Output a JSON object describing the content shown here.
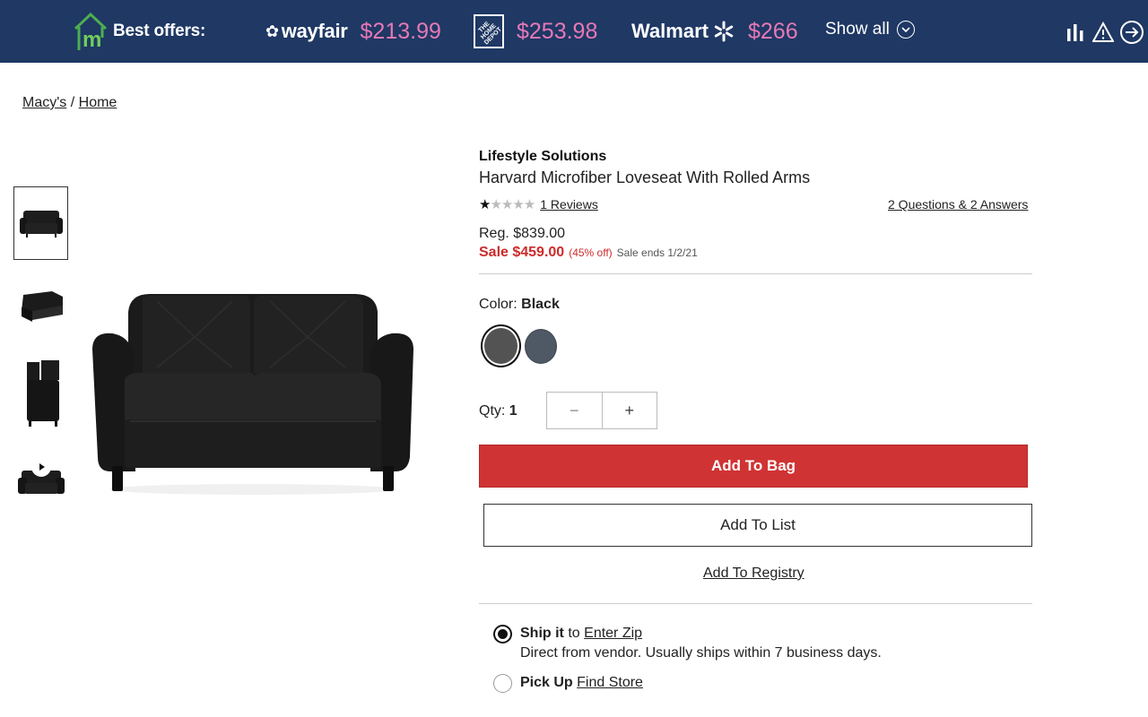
{
  "offers_bar": {
    "label": "Best offers:",
    "stores": [
      {
        "name": "wayfair",
        "price": "$213.99"
      },
      {
        "name": "THE HOME DEPOT",
        "price": "$253.98"
      },
      {
        "name": "Walmart",
        "price": "$266"
      }
    ],
    "show_all": "Show all",
    "bg_color": "#1f3864",
    "price_color": "#e679b6",
    "icons": [
      "m-house-logo-icon",
      "bar-chart-icon",
      "warning-icon",
      "exit-icon"
    ]
  },
  "breadcrumb": {
    "items": [
      "Macy's",
      "Home"
    ],
    "separator": "/"
  },
  "product": {
    "brand": "Lifestyle Solutions",
    "title": "Harvard Microfiber Loveseat With Rolled Arms",
    "rating_stars": 1,
    "rating_max": 5,
    "reviews_link": "1 Reviews",
    "qa_link": "2 Questions & 2 Answers",
    "reg_price": "Reg. $839.00",
    "sale_price": "Sale $459.00",
    "discount": "(45% off)",
    "sale_ends": "Sale ends 1/2/21",
    "color_label": "Color:",
    "color_value": "Black",
    "swatches": [
      "#535353",
      "#4f5865"
    ],
    "qty_label": "Qty:",
    "qty_value": "1",
    "minus": "−",
    "plus": "+",
    "add_to_bag": "Add To Bag",
    "add_to_list": "Add To List",
    "add_to_registry": "Add To Registry",
    "accent_color": "#d03333"
  },
  "fulfillment": {
    "ship_bold": "Ship it",
    "ship_to": "to",
    "ship_link": "Enter Zip",
    "ship_desc": "Direct from vendor. Usually ships within 7 business days.",
    "pickup_bold": "Pick Up",
    "pickup_link": "Find Store"
  }
}
